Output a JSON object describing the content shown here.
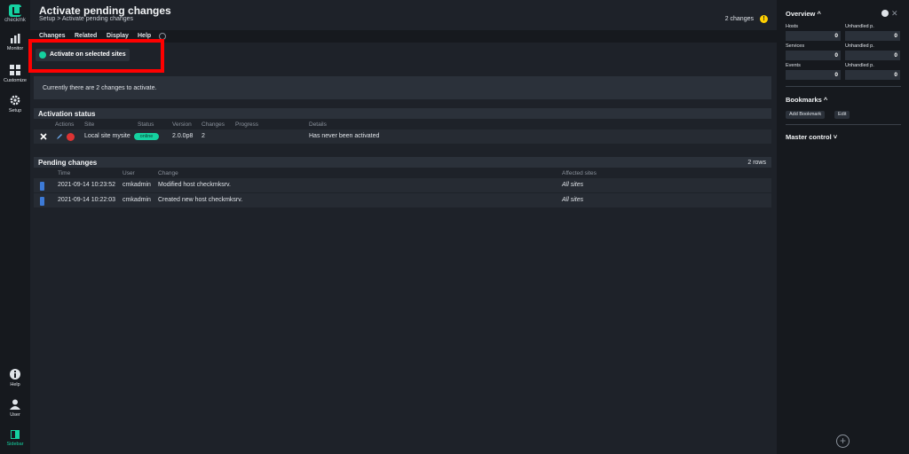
{
  "leftnav": {
    "logo_text": "checkmk",
    "top_items": [
      {
        "label": "Monitor",
        "icon": "bar-chart-icon"
      },
      {
        "label": "Customize",
        "icon": "grid-icon"
      },
      {
        "label": "Setup",
        "icon": "gear-icon"
      }
    ],
    "bottom_items": [
      {
        "label": "Help",
        "icon": "info-icon"
      },
      {
        "label": "User",
        "icon": "user-icon"
      },
      {
        "label": "Sidebar",
        "icon": "sidebar-icon"
      }
    ]
  },
  "header": {
    "title": "Activate pending changes",
    "breadcrumb": "Setup > Activate pending changes",
    "changes_count": "2 changes",
    "warn_symbol": "!"
  },
  "menu": {
    "items": [
      "Changes",
      "Related",
      "Display",
      "Help"
    ]
  },
  "shortcut": {
    "activate_label": "Activate on selected sites"
  },
  "info": "Currently there are 2 changes to activate.",
  "activation_status": {
    "title": "Activation status",
    "columns": [
      "Actions",
      "Site",
      "Status",
      "Version",
      "Changes",
      "Progress",
      "Details"
    ],
    "rows": [
      {
        "site": "Local site mysite",
        "status": "online",
        "version": "2.0.0p8",
        "changes": "2",
        "progress": "",
        "details": "Has never been activated"
      }
    ]
  },
  "pending_changes": {
    "title": "Pending changes",
    "rows_count": "2 rows",
    "columns": [
      "Time",
      "User",
      "Change",
      "Affected sites"
    ],
    "rows": [
      {
        "time": "2021-09-14 10:23:52",
        "user": "cmkadmin",
        "change": "Modified host checkmksrv.",
        "affected": "All sites"
      },
      {
        "time": "2021-09-14 10:22:03",
        "user": "cmkadmin",
        "change": "Created new host checkmksrv.",
        "affected": "All sites"
      }
    ]
  },
  "sidebar": {
    "overview_title": "Overview ^",
    "stats": [
      {
        "label": "Hosts",
        "value": "0",
        "unhandled_label": "Unhandled p.",
        "unhandled_value": "0"
      },
      {
        "label": "Services",
        "value": "0",
        "unhandled_label": "Unhandled p.",
        "unhandled_value": "0"
      },
      {
        "label": "Events",
        "value": "0",
        "unhandled_label": "Unhandled p.",
        "unhandled_value": "0"
      }
    ],
    "bookmarks_title": "Bookmarks ^",
    "add_bookmark": "Add Bookmark",
    "edit": "Edit",
    "master_control_title": "Master control ˅",
    "add_symbol": "+"
  },
  "colors": {
    "accent": "#15d1a0",
    "highlight": "#ff0000",
    "warning": "#ffd000"
  }
}
